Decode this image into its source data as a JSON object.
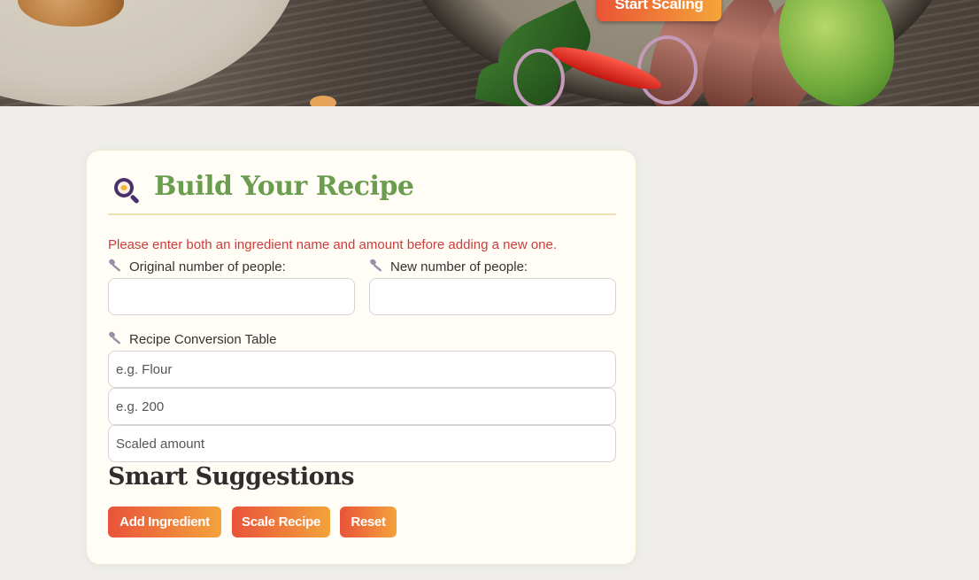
{
  "hero": {
    "start_button_label": "Start Scaling"
  },
  "card": {
    "title": "Build Your Recipe",
    "icon": "frying-pan-icon",
    "error_message": "Please enter both an ingredient name and amount before adding a new one.",
    "original_people_label": "Original number of people:",
    "original_people_value": "",
    "new_people_label": "New number of people:",
    "new_people_value": "",
    "conversion_table_label": "Recipe Conversion Table",
    "ingredient_placeholder": "e.g. Flour",
    "amount_placeholder": "e.g. 200",
    "scaled_placeholder": "Scaled amount",
    "suggestions_heading": "Smart Suggestions",
    "buttons": {
      "add_ingredient": "Add Ingredient",
      "scale_recipe": "Scale Recipe",
      "reset": "Reset"
    }
  },
  "colors": {
    "title_green": "#6a9e4e",
    "error_red": "#d03b3b",
    "button_gradient_start": "#e9533a",
    "button_gradient_end": "#f3a33b",
    "card_background": "#fffdf5"
  }
}
